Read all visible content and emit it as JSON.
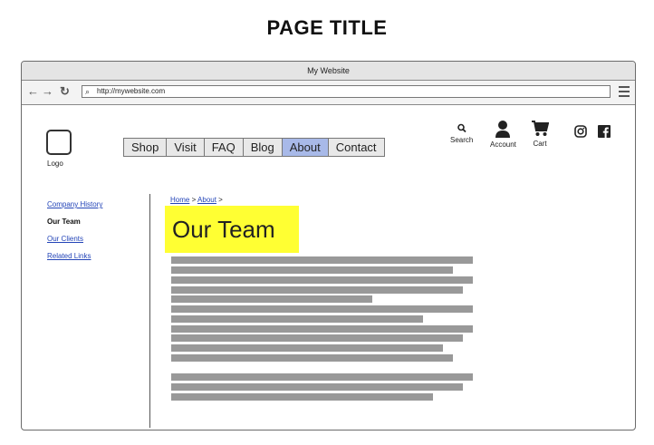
{
  "page_title": "PAGE TITLE",
  "browser": {
    "window_title": "My Website",
    "back_icon": "←",
    "forward_icon": "→",
    "reload_icon": "↻",
    "url": "http://mywebsite.com",
    "search_glyph": "⌕"
  },
  "logo": {
    "label": "Logo"
  },
  "main_nav": [
    "Shop",
    "Visit",
    "FAQ",
    "Blog",
    "About",
    "Contact"
  ],
  "active_nav": "About",
  "utility": {
    "search": "Search",
    "account": "Account",
    "cart": "Cart"
  },
  "sidebar": [
    {
      "label": "Company History",
      "current": false
    },
    {
      "label": "Our Team",
      "current": true
    },
    {
      "label": "Our Clients",
      "current": false
    },
    {
      "label": "Related Links",
      "current": false
    }
  ],
  "breadcrumb": {
    "home": "Home",
    "sep": ">",
    "about": "About"
  },
  "heading": "Our Team",
  "colors": {
    "heading_highlight": "#ffff33",
    "active_nav": "#a8b9e8",
    "link": "#2445b8",
    "text_bar": "#999999"
  }
}
